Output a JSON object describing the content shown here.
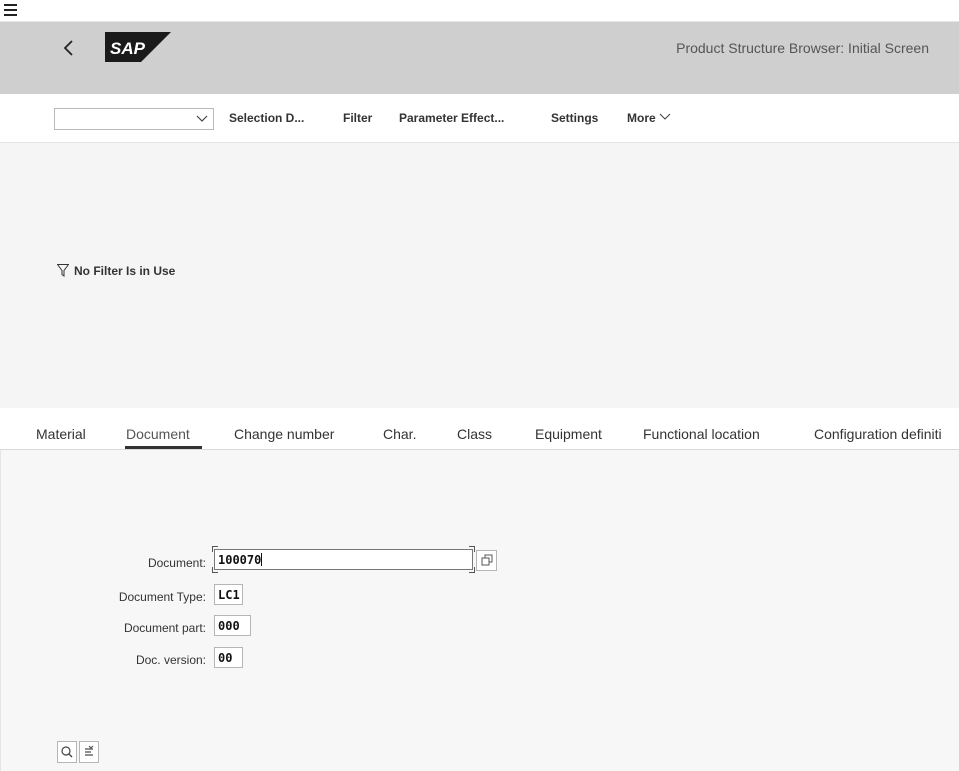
{
  "shell": {
    "title": "Product Structure Browser: Initial Screen",
    "logo_text": "SAP"
  },
  "toolbar": {
    "select_value": "",
    "items": [
      "Selection D...",
      "Filter",
      "Parameter Effect...",
      "Settings",
      "More"
    ]
  },
  "filter": {
    "status_text": "No Filter Is in Use"
  },
  "tabs": [
    "Material",
    "Document",
    "Change number",
    "Char.",
    "Class",
    "Equipment",
    "Functional location",
    "Configuration definiti"
  ],
  "active_tab": "Document",
  "form": {
    "document_label": "Document:",
    "document_value": "100070",
    "doc_type_label": "Document Type:",
    "doc_type_value": "LC1",
    "doc_part_label": "Document part:",
    "doc_part_value": "000",
    "doc_version_label": "Doc. version:",
    "doc_version_value": "00"
  },
  "colors": {
    "shell_bar": "#cfcfcf",
    "filter_area": "#f5f5f5",
    "content_area": "#f7f7f7"
  }
}
